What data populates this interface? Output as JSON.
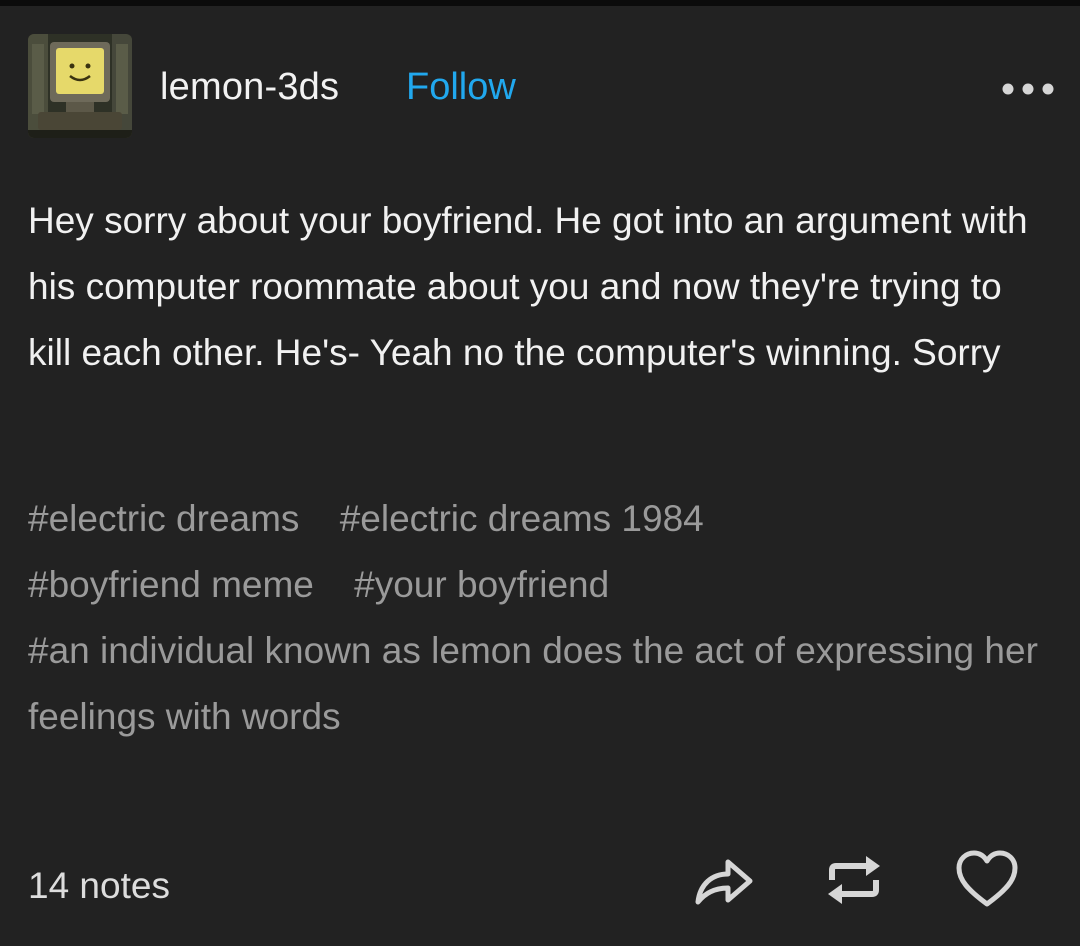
{
  "post": {
    "username": "lemon-3ds",
    "follow_label": "Follow",
    "more_icon": "more-dots-icon",
    "body": "Hey sorry about your boyfriend. He got into an argument with his computer roommate about you and now they're trying to kill each other. He's- Yeah no the computer's winning. Sorry",
    "tags": [
      "#electric dreams",
      "#electric dreams 1984",
      "#boyfriend meme",
      "#your boyfriend",
      "#an individual known as lemon does the act of expressing her feelings with words"
    ],
    "notes": "14 notes",
    "actions": [
      "share-icon",
      "reblog-icon",
      "heart-icon"
    ]
  },
  "colors": {
    "background": "#222222",
    "follow": "#21a8ee",
    "tag_text": "#9a9a9a",
    "body_text": "#f1f1f1"
  }
}
